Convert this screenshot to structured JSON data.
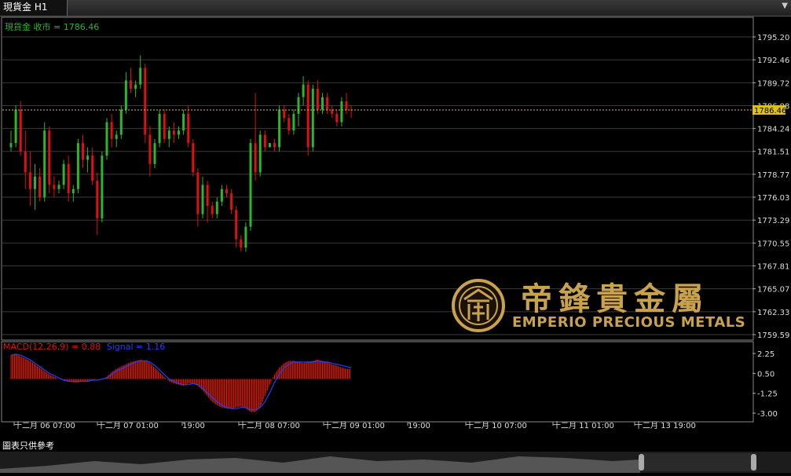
{
  "window": {
    "tab_label": "現貨金 H1"
  },
  "price_header": "現貨金 收市 = 1786.46",
  "macd_header": {
    "label": "MACD(12,26,9) = 0.88",
    "signal": "Signal = 1.16"
  },
  "current_price": "1786.46",
  "footer_note": "圖表只供參考",
  "logo": {
    "chinese": "帝鋒貴金屬",
    "english": "EMPERIO PRECIOUS METALS"
  },
  "colors": {
    "up": "#2db52d",
    "down": "#e01010",
    "grid": "#3a3a3a",
    "macd_hist": "#d02010",
    "signal": "#2040ff",
    "price_line": "#e0c020",
    "logo": "#c9a24e"
  },
  "chart_data": {
    "type": "candlestick",
    "price_axis": {
      "ticks": [
        "1795.20",
        "1792.46",
        "1789.72",
        "1786.98",
        "1784.24",
        "1781.51",
        "1778.77",
        "1776.03",
        "1773.29",
        "1770.55",
        "1767.81",
        "1765.07",
        "1762.33",
        "1759.59"
      ],
      "range": [
        1759.59,
        1795.2
      ]
    },
    "macd_axis": {
      "ticks": [
        "2.25",
        "0.50",
        "-1.25",
        "-3.00"
      ],
      "range": [
        -3.0,
        2.25
      ]
    },
    "time_labels": [
      "十二月 06 07:00",
      "十二月 07 01:00",
      "19:00",
      "十二月 08 07:00",
      "十二月 09 01:00",
      "19:00",
      "十二月 10 07:00",
      "十二月 11 01:00",
      "十二月 13 19:00"
    ],
    "macd_values": [
      2.1,
      2.2,
      2.0,
      1.8,
      1.6,
      1.3,
      1.0,
      0.7,
      0.4,
      0.2,
      0.0,
      -0.1,
      -0.2,
      -0.3,
      -0.3,
      -0.2,
      -0.2,
      -0.1,
      0.0,
      0.0,
      0.2,
      0.6,
      0.9,
      1.1,
      1.3,
      1.5,
      1.6,
      1.7,
      1.6,
      1.4,
      1.0,
      0.6,
      0.2,
      -0.2,
      -0.4,
      -0.5,
      -0.6,
      -0.4,
      -0.4,
      -0.6,
      -1.0,
      -1.5,
      -2.0,
      -2.3,
      -2.5,
      -2.6,
      -2.6,
      -2.5,
      -2.4,
      -2.6,
      -2.9,
      -2.9,
      -2.5,
      -1.5,
      -0.5,
      0.4,
      1.0,
      1.4,
      1.6,
      1.6,
      1.5,
      1.4,
      1.5,
      1.6,
      1.7,
      1.6,
      1.5,
      1.3,
      1.2,
      1.0,
      0.9,
      0.9
    ],
    "signal_values": [
      2.1,
      2.2,
      2.1,
      1.9,
      1.7,
      1.4,
      1.1,
      0.8,
      0.5,
      0.3,
      0.1,
      -0.1,
      -0.2,
      -0.2,
      -0.2,
      -0.2,
      -0.2,
      -0.1,
      -0.1,
      0.0,
      0.1,
      0.4,
      0.7,
      0.9,
      1.1,
      1.3,
      1.5,
      1.6,
      1.6,
      1.5,
      1.2,
      0.8,
      0.4,
      0.0,
      -0.2,
      -0.4,
      -0.5,
      -0.5,
      -0.4,
      -0.5,
      -0.8,
      -1.2,
      -1.6,
      -2.0,
      -2.3,
      -2.5,
      -2.6,
      -2.6,
      -2.5,
      -2.5,
      -2.7,
      -2.7,
      -2.5,
      -2.0,
      -1.2,
      -0.3,
      0.4,
      1.0,
      1.3,
      1.5,
      1.5,
      1.5,
      1.5,
      1.5,
      1.6,
      1.5,
      1.5,
      1.4,
      1.3,
      1.2,
      1.1,
      1.0
    ],
    "candles": [
      {
        "o": 1782.0,
        "h": 1784.0,
        "l": 1781.5,
        "c": 1782.5
      },
      {
        "o": 1782.5,
        "h": 1787.0,
        "l": 1782.0,
        "c": 1786.5
      },
      {
        "o": 1786.5,
        "h": 1787.5,
        "l": 1781.0,
        "c": 1781.5
      },
      {
        "o": 1781.5,
        "h": 1784.0,
        "l": 1777.0,
        "c": 1779.0
      },
      {
        "o": 1779.0,
        "h": 1781.5,
        "l": 1775.0,
        "c": 1777.0
      },
      {
        "o": 1777.0,
        "h": 1780.0,
        "l": 1774.5,
        "c": 1778.5
      },
      {
        "o": 1778.5,
        "h": 1779.5,
        "l": 1775.5,
        "c": 1776.0
      },
      {
        "o": 1776.0,
        "h": 1785.0,
        "l": 1775.5,
        "c": 1784.0
      },
      {
        "o": 1784.0,
        "h": 1784.5,
        "l": 1776.5,
        "c": 1777.5
      },
      {
        "o": 1777.5,
        "h": 1778.5,
        "l": 1776.0,
        "c": 1777.0
      },
      {
        "o": 1777.0,
        "h": 1778.0,
        "l": 1776.5,
        "c": 1777.5
      },
      {
        "o": 1777.5,
        "h": 1780.5,
        "l": 1777.0,
        "c": 1780.0
      },
      {
        "o": 1780.0,
        "h": 1781.0,
        "l": 1775.5,
        "c": 1776.5
      },
      {
        "o": 1776.5,
        "h": 1777.5,
        "l": 1775.5,
        "c": 1777.0
      },
      {
        "o": 1777.0,
        "h": 1783.0,
        "l": 1776.5,
        "c": 1782.5
      },
      {
        "o": 1782.5,
        "h": 1783.5,
        "l": 1779.5,
        "c": 1780.5
      },
      {
        "o": 1780.5,
        "h": 1782.0,
        "l": 1779.0,
        "c": 1781.0
      },
      {
        "o": 1781.0,
        "h": 1782.0,
        "l": 1777.5,
        "c": 1778.0
      },
      {
        "o": 1778.0,
        "h": 1779.0,
        "l": 1771.5,
        "c": 1773.5
      },
      {
        "o": 1773.5,
        "h": 1781.5,
        "l": 1773.0,
        "c": 1781.0
      },
      {
        "o": 1781.0,
        "h": 1785.5,
        "l": 1780.5,
        "c": 1785.0
      },
      {
        "o": 1785.0,
        "h": 1786.0,
        "l": 1782.0,
        "c": 1783.0
      },
      {
        "o": 1783.0,
        "h": 1784.0,
        "l": 1782.0,
        "c": 1783.5
      },
      {
        "o": 1783.5,
        "h": 1787.0,
        "l": 1783.0,
        "c": 1786.5
      },
      {
        "o": 1786.5,
        "h": 1791.0,
        "l": 1786.0,
        "c": 1790.0
      },
      {
        "o": 1790.0,
        "h": 1791.5,
        "l": 1788.5,
        "c": 1789.0
      },
      {
        "o": 1789.0,
        "h": 1790.0,
        "l": 1788.0,
        "c": 1789.5
      },
      {
        "o": 1789.5,
        "h": 1793.0,
        "l": 1789.0,
        "c": 1791.5
      },
      {
        "o": 1791.5,
        "h": 1792.0,
        "l": 1782.5,
        "c": 1783.5
      },
      {
        "o": 1783.5,
        "h": 1784.5,
        "l": 1778.5,
        "c": 1780.0
      },
      {
        "o": 1780.0,
        "h": 1783.0,
        "l": 1779.5,
        "c": 1782.5
      },
      {
        "o": 1782.5,
        "h": 1786.5,
        "l": 1782.0,
        "c": 1786.0
      },
      {
        "o": 1786.0,
        "h": 1786.5,
        "l": 1782.5,
        "c": 1783.0
      },
      {
        "o": 1783.0,
        "h": 1784.5,
        "l": 1782.0,
        "c": 1784.0
      },
      {
        "o": 1784.0,
        "h": 1785.0,
        "l": 1782.5,
        "c": 1783.5
      },
      {
        "o": 1783.5,
        "h": 1784.5,
        "l": 1783.0,
        "c": 1784.0
      },
      {
        "o": 1784.0,
        "h": 1786.5,
        "l": 1783.5,
        "c": 1786.0
      },
      {
        "o": 1786.0,
        "h": 1787.0,
        "l": 1782.0,
        "c": 1782.5
      },
      {
        "o": 1782.5,
        "h": 1783.0,
        "l": 1778.5,
        "c": 1779.0
      },
      {
        "o": 1779.0,
        "h": 1779.5,
        "l": 1772.5,
        "c": 1774.0
      },
      {
        "o": 1774.0,
        "h": 1778.5,
        "l": 1773.5,
        "c": 1777.5
      },
      {
        "o": 1777.5,
        "h": 1778.0,
        "l": 1773.0,
        "c": 1775.0
      },
      {
        "o": 1775.0,
        "h": 1775.5,
        "l": 1773.5,
        "c": 1774.0
      },
      {
        "o": 1774.0,
        "h": 1776.0,
        "l": 1773.5,
        "c": 1775.5
      },
      {
        "o": 1775.5,
        "h": 1777.5,
        "l": 1775.0,
        "c": 1777.0
      },
      {
        "o": 1777.0,
        "h": 1777.5,
        "l": 1776.0,
        "c": 1776.5
      },
      {
        "o": 1776.5,
        "h": 1777.0,
        "l": 1774.0,
        "c": 1774.5
      },
      {
        "o": 1774.5,
        "h": 1775.0,
        "l": 1770.0,
        "c": 1771.0
      },
      {
        "o": 1771.0,
        "h": 1771.5,
        "l": 1769.5,
        "c": 1770.0
      },
      {
        "o": 1770.0,
        "h": 1773.0,
        "l": 1769.5,
        "c": 1772.5
      },
      {
        "o": 1772.5,
        "h": 1783.0,
        "l": 1772.0,
        "c": 1782.5
      },
      {
        "o": 1782.5,
        "h": 1788.5,
        "l": 1778.0,
        "c": 1779.0
      },
      {
        "o": 1779.0,
        "h": 1784.0,
        "l": 1778.5,
        "c": 1783.5
      },
      {
        "o": 1783.5,
        "h": 1784.0,
        "l": 1781.5,
        "c": 1782.0
      },
      {
        "o": 1782.0,
        "h": 1782.5,
        "l": 1782.0,
        "c": 1782.5
      },
      {
        "o": 1782.5,
        "h": 1783.0,
        "l": 1781.5,
        "c": 1782.0
      },
      {
        "o": 1782.0,
        "h": 1787.0,
        "l": 1781.5,
        "c": 1786.5
      },
      {
        "o": 1786.5,
        "h": 1787.0,
        "l": 1785.0,
        "c": 1785.5
      },
      {
        "o": 1785.5,
        "h": 1786.0,
        "l": 1783.5,
        "c": 1784.0
      },
      {
        "o": 1784.0,
        "h": 1786.5,
        "l": 1783.5,
        "c": 1786.0
      },
      {
        "o": 1786.0,
        "h": 1788.5,
        "l": 1784.5,
        "c": 1788.0
      },
      {
        "o": 1788.0,
        "h": 1790.5,
        "l": 1787.0,
        "c": 1789.5
      },
      {
        "o": 1789.5,
        "h": 1790.0,
        "l": 1781.0,
        "c": 1782.0
      },
      {
        "o": 1782.0,
        "h": 1789.5,
        "l": 1781.5,
        "c": 1789.0
      },
      {
        "o": 1789.0,
        "h": 1790.0,
        "l": 1786.0,
        "c": 1786.5
      },
      {
        "o": 1786.5,
        "h": 1788.5,
        "l": 1786.0,
        "c": 1788.0
      },
      {
        "o": 1788.0,
        "h": 1788.5,
        "l": 1786.0,
        "c": 1786.5
      },
      {
        "o": 1786.5,
        "h": 1787.0,
        "l": 1785.5,
        "c": 1786.0
      },
      {
        "o": 1786.0,
        "h": 1786.5,
        "l": 1784.5,
        "c": 1785.0
      },
      {
        "o": 1785.0,
        "h": 1788.0,
        "l": 1784.5,
        "c": 1787.5
      },
      {
        "o": 1787.5,
        "h": 1788.5,
        "l": 1786.0,
        "c": 1786.5
      },
      {
        "o": 1786.5,
        "h": 1787.0,
        "l": 1785.5,
        "c": 1786.46
      }
    ]
  }
}
